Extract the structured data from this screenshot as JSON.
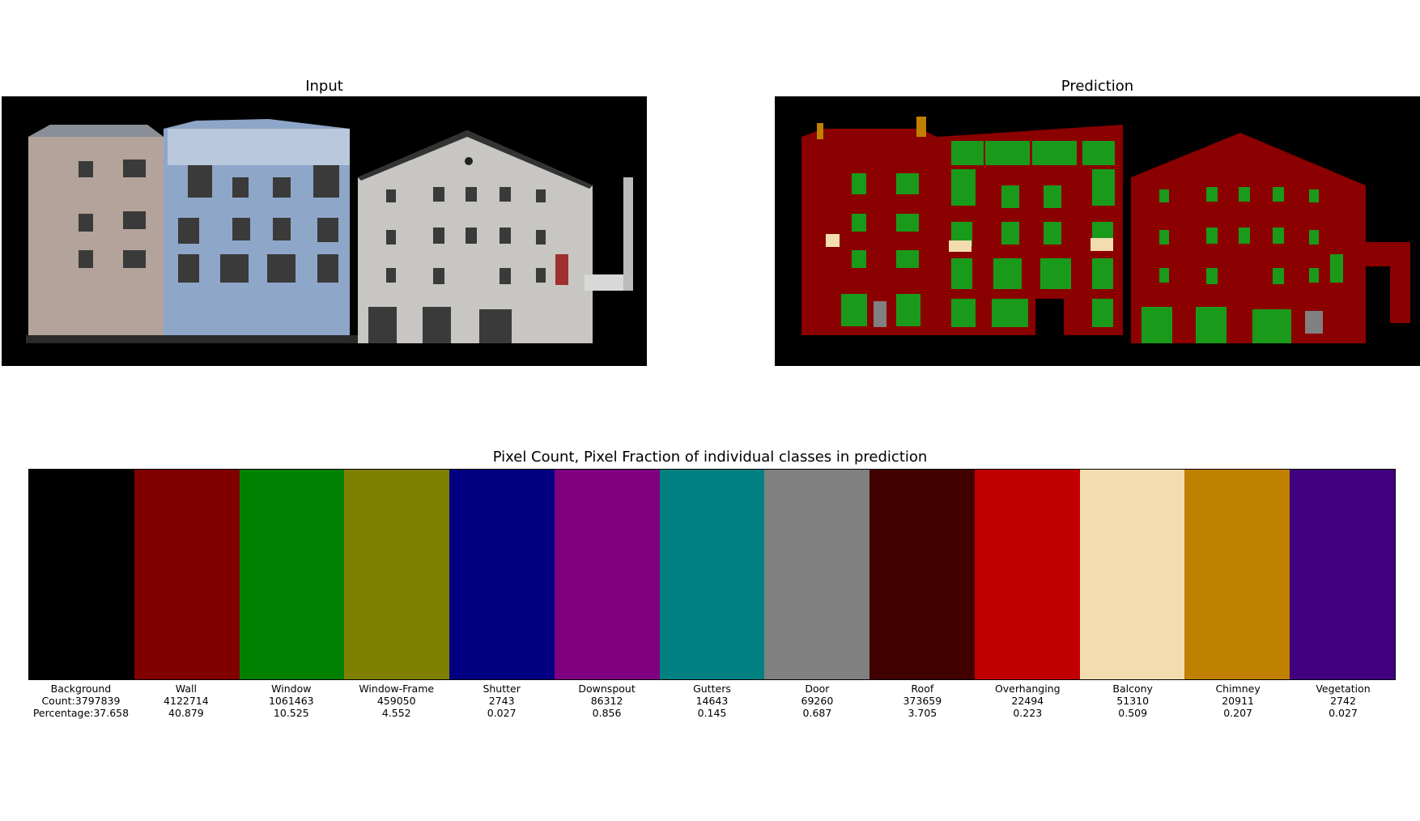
{
  "panels": {
    "input_title": "Input",
    "prediction_title": "Prediction"
  },
  "chart_data": {
    "type": "bar",
    "title": "Pixel Count, Pixel Fraction of individual classes in prediction",
    "count_prefix": "Count:",
    "percentage_prefix": "Percentage:",
    "categories": [
      "Background",
      "Wall",
      "Window",
      "Window-Frame",
      "Shutter",
      "Downspout",
      "Gutters",
      "Door",
      "Roof",
      "Overhanging",
      "Balcony",
      "Chimney",
      "Vegetation"
    ],
    "counts": [
      3797839,
      4122714,
      1061463,
      459050,
      2743,
      86312,
      14643,
      69260,
      373659,
      22494,
      51310,
      20911,
      2742
    ],
    "percentages": [
      "37.658",
      "40.879",
      "10.525",
      "4.552",
      "0.027",
      "0.856",
      "0.145",
      "0.687",
      "3.705",
      "0.223",
      "0.509",
      "0.207",
      "0.027"
    ],
    "colors": [
      "#000000",
      "#800000",
      "#008000",
      "#808000",
      "#000080",
      "#800080",
      "#008080",
      "#808080",
      "#400000",
      "#c00000",
      "#f2dcb0",
      "#c08000",
      "#400080"
    ]
  }
}
